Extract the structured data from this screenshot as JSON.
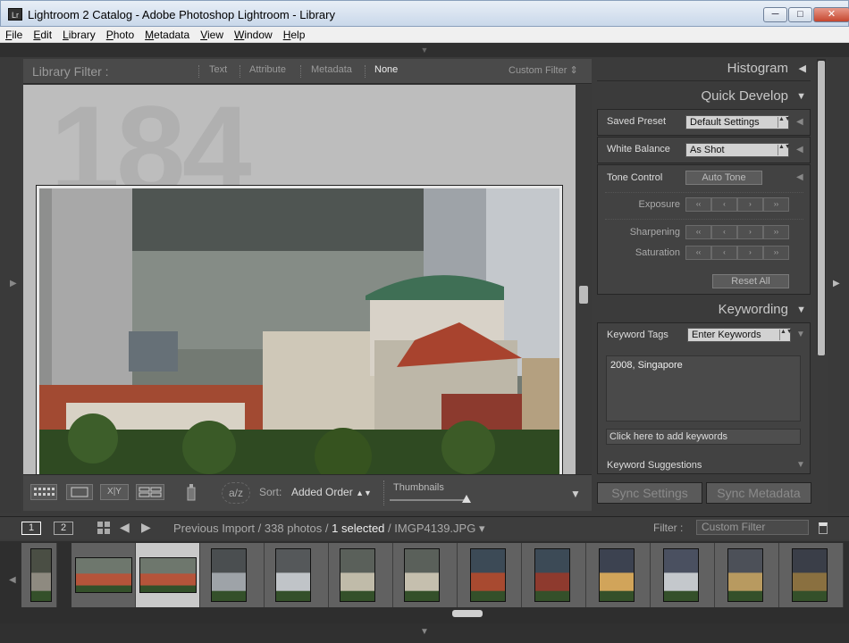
{
  "window": {
    "title": "Lightroom 2 Catalog - Adobe Photoshop Lightroom - Library",
    "app_icon": "Lr",
    "minimize": "─",
    "maximize": "□",
    "close": "✕"
  },
  "menu": [
    "File",
    "Edit",
    "Library",
    "Photo",
    "Metadata",
    "View",
    "Window",
    "Help"
  ],
  "library_filter": {
    "label": "Library Filter :",
    "items": [
      "Text",
      "Attribute",
      "Metadata",
      "None"
    ],
    "selected": "None",
    "preset": "Custom Filter ⇕"
  },
  "grid": {
    "cell_index": "184"
  },
  "toolbar": {
    "sort_label": "Sort:",
    "sort_value": "Added Order",
    "thumbnails_label": "Thumbnails",
    "thumbnail_size": 0.7,
    "icons": [
      "grid-view-icon",
      "loupe-view-icon",
      "compare-view-icon",
      "survey-view-icon",
      "painter-icon",
      "sort-az-icon"
    ]
  },
  "panels": {
    "histogram": "Histogram",
    "quick_develop": "Quick Develop",
    "saved_preset_label": "Saved Preset",
    "saved_preset_value": "Default Settings",
    "white_balance_label": "White Balance",
    "white_balance_value": "As Shot",
    "tone_control_label": "Tone Control",
    "auto_tone": "Auto Tone",
    "exposure": "Exposure",
    "sharpening": "Sharpening",
    "saturation": "Saturation",
    "reset_all": "Reset All",
    "keywording": "Keywording",
    "keyword_tags_label": "Keyword Tags",
    "keyword_tags_value": "Enter Keywords",
    "keywords": "2008, Singapore",
    "add_keywords": "Click here to add keywords",
    "keyword_suggestions": "Keyword Suggestions",
    "sync_settings": "Sync Settings",
    "sync_metadata": "Sync Metadata"
  },
  "filmstrip_bar": {
    "page1": "1",
    "page2": "2",
    "source": "Previous Import",
    "count": "338 photos",
    "selected": "1 selected",
    "filename": "IMGP4139.JPG",
    "filter_label": "Filter :",
    "filter_value": "Custom Filter"
  },
  "glyphs": {
    "stepper": [
      "‹‹",
      "‹",
      "›",
      "››"
    ],
    "tri_left": "◀",
    "tri_down": "▼",
    "updown": "▲▼",
    "caret_down": "▾",
    "left": "◀",
    "right": "▶",
    "sort_icon": "a/z",
    "sep": "/"
  },
  "colors": {
    "panel": "#3b3b3b",
    "grid_bg": "#bdbdbd",
    "selected_cell": "#c9c9c9"
  }
}
